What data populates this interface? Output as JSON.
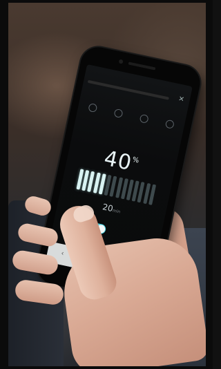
{
  "phone_screen": {
    "percent_value": "40",
    "percent_unit": "%",
    "minutes_value": "20",
    "minutes_unit": "min",
    "bars_total": 14,
    "bars_on": 5,
    "toggle_on": true
  },
  "colors": {
    "accent": "#4ad3e0",
    "screen_bg": "#0b0c0d",
    "skin": "#d9a994"
  },
  "icon_names": [
    "close-icon",
    "charge-icon",
    "status-icon",
    "settings-icon"
  ]
}
